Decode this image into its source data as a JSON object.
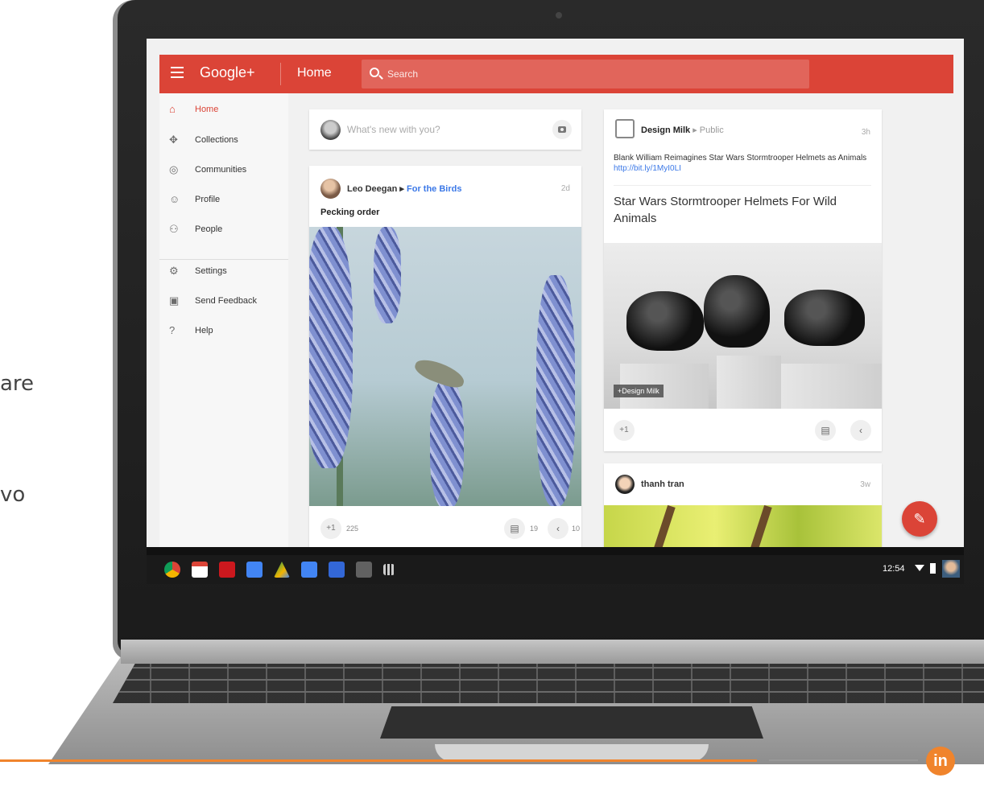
{
  "slide_fragments": [
    "are",
    "vo"
  ],
  "app": {
    "logo": "Google+",
    "page_title": "Home",
    "search_placeholder": "Search",
    "accent": "#db4437"
  },
  "sidebar": {
    "items": [
      {
        "label": "Home",
        "icon": "home-icon",
        "active": true
      },
      {
        "label": "Collections",
        "icon": "collections-icon"
      },
      {
        "label": "Communities",
        "icon": "communities-icon"
      },
      {
        "label": "Profile",
        "icon": "profile-icon"
      },
      {
        "label": "People",
        "icon": "people-icon"
      },
      {
        "label": "Settings",
        "icon": "settings-icon"
      },
      {
        "label": "Send Feedback",
        "icon": "feedback-icon"
      },
      {
        "label": "Help",
        "icon": "help-icon"
      }
    ]
  },
  "compose": {
    "placeholder": "What's new with you?"
  },
  "post_bird": {
    "author": "Leo Deegan",
    "community": "For the Birds",
    "time": "2d",
    "title": "Pecking order",
    "plus_label": "+1",
    "plus_count": "225",
    "comment_count": "19",
    "share_count": "10"
  },
  "post_design": {
    "author": "Design Milk",
    "visibility": "Public",
    "time": "3h",
    "text": "Blank William Reimagines Star Wars Stormtrooper Helmets as Animals",
    "link": "http://bit.ly/1MyI0LI",
    "headline": "Star Wars Stormtrooper Helmets For Wild Animals",
    "tag": "+Design Milk",
    "plus_label": "+1"
  },
  "post_thanh": {
    "author": "thanh tran",
    "time": "3w"
  },
  "shelf": {
    "clock": "12:54",
    "apps": [
      "chrome-icon",
      "gmail-icon",
      "youtube-icon",
      "google-plus-icon",
      "drive-icon",
      "docs-icon",
      "files-icon",
      "store-icon",
      "launcher-icon"
    ]
  },
  "brand": {
    "badge": "in",
    "accent": "#f0842c"
  }
}
